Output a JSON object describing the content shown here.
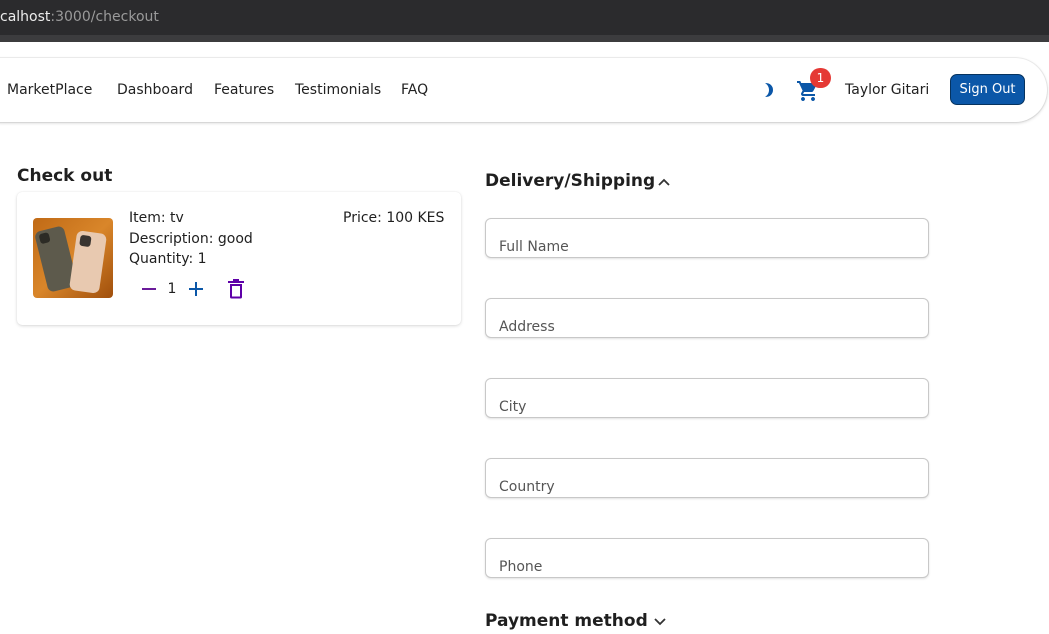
{
  "browser": {
    "url_host": "calhost",
    "url_path": ":3000/checkout"
  },
  "navbar": {
    "brand": "MarketPlace",
    "links": [
      "Dashboard",
      "Features",
      "Testimonials",
      "FAQ"
    ],
    "theme_icon": "half-moon-icon",
    "cart_icon": "shopping-cart-icon",
    "cart_count": "1",
    "user_name": "Taylor Gitari",
    "sign_out_label": "Sign Out",
    "colors": {
      "accent": "#0b57a8",
      "badge": "#e53935"
    }
  },
  "checkout": {
    "title": "Check out",
    "item": {
      "image_icon": "phone-product-image",
      "name_line": "Item: tv",
      "description_line": "Description: good",
      "quantity_line": "Quantity: 1",
      "price_line": "Price: 100 KES",
      "quantity_value": "1",
      "minus_color": "#6a1b9a",
      "plus_color": "#0b57a8",
      "delete_color": "#5e00a8"
    }
  },
  "delivery": {
    "title": "Delivery/Shipping",
    "expanded": true,
    "fields": [
      {
        "placeholder": "Full Name",
        "value": ""
      },
      {
        "placeholder": "Address",
        "value": ""
      },
      {
        "placeholder": "City",
        "value": ""
      },
      {
        "placeholder": "Country",
        "value": ""
      },
      {
        "placeholder": "Phone",
        "value": ""
      }
    ]
  },
  "payment": {
    "title": "Payment method",
    "expanded": false
  }
}
